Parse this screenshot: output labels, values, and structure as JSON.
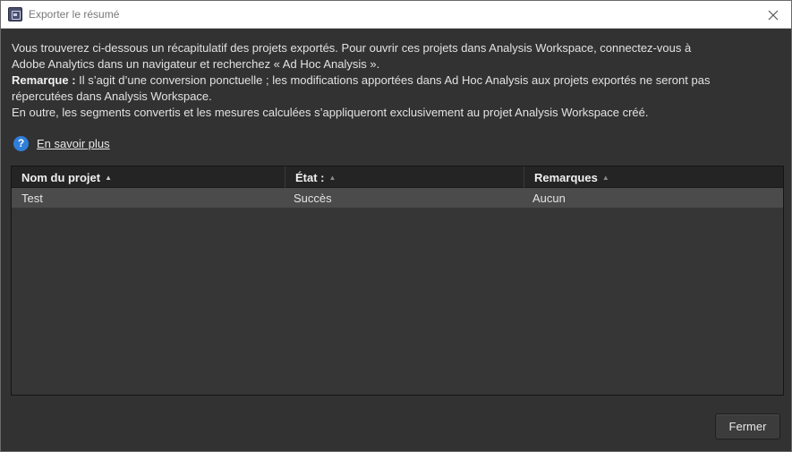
{
  "window": {
    "title": "Exporter le résumé",
    "close_icon": "close-icon",
    "app_icon": "app-icon"
  },
  "message": {
    "line1": "Vous trouverez ci-dessous un récapitulatif des projets exportés. Pour ouvrir ces projets dans Analysis Workspace, connectez-vous à",
    "line2": "Adobe Analytics dans un navigateur et recherchez « Ad Hoc Analysis ».",
    "note_label": "Remarque :",
    "note_line1": " Il s’agit d’une conversion ponctuelle ; les modifications apportées dans Ad Hoc Analysis aux projets exportés ne seront pas",
    "note_line2": "répercutées dans Analysis Workspace.",
    "line_extra": "En outre, les segments convertis et les mesures calculées s’appliqueront exclusivement au projet Analysis Workspace créé."
  },
  "learn_more": {
    "icon": "help-icon",
    "icon_glyph": "?",
    "label": "En savoir plus"
  },
  "table": {
    "columns": [
      {
        "label": "Nom du projet",
        "sort": "ascending"
      },
      {
        "label": "État :",
        "sort": "none"
      },
      {
        "label": "Remarques",
        "sort": "none"
      }
    ],
    "rows": [
      {
        "project": "Test",
        "status": "Succès",
        "notes": "Aucun"
      }
    ]
  },
  "footer": {
    "close_label": "Fermer"
  },
  "colors": {
    "background": "#323232",
    "header": "#242424",
    "selected_row": "#4b4b4b",
    "accent_help": "#2f7fd8"
  }
}
